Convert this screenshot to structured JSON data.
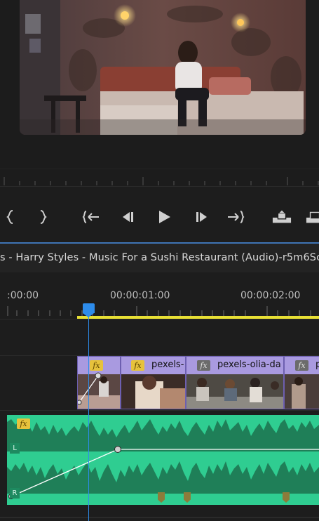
{
  "program_monitor": {
    "preview": "video-frame"
  },
  "transport": {
    "buttons": [
      {
        "name": "mark-in-icon",
        "glyph": "{"
      },
      {
        "name": "mark-out-icon",
        "glyph": "}"
      },
      {
        "name": "go-to-in-icon",
        "glyph": "{←"
      },
      {
        "name": "step-back-icon",
        "glyph": "◀|"
      },
      {
        "name": "play-icon",
        "glyph": "▶"
      },
      {
        "name": "step-forward-icon",
        "glyph": "|▶"
      },
      {
        "name": "go-to-out-icon",
        "glyph": "→}"
      },
      {
        "name": "lift-icon",
        "glyph": "lift"
      },
      {
        "name": "extract-icon",
        "glyph": "extract"
      }
    ]
  },
  "sequence": {
    "tab_title": "s - Harry Styles - Music For a Sushi Restaurant (Audio)-r5m6Sc"
  },
  "timeline": {
    "timecodes": [
      ":00:00",
      "00:00:01:00",
      "00:00:02:00"
    ],
    "video_clips": [
      {
        "name": "",
        "fx": "yellow"
      },
      {
        "name": "pexels-",
        "fx": "yellow"
      },
      {
        "name": "pexels-olia-da",
        "fx": "gray"
      },
      {
        "name": "p",
        "fx": "gray"
      }
    ],
    "audio_clip": {
      "fx": "fx",
      "channels": [
        "L",
        "R"
      ]
    },
    "fx_label": "fx"
  },
  "colors": {
    "accent_blue": "#2d8ceb",
    "work_area_yellow": "#e8e035",
    "video_clip": "#9b8ad6",
    "audio_clip": "#2fcd91",
    "audio_wave": "#1f7f58"
  }
}
